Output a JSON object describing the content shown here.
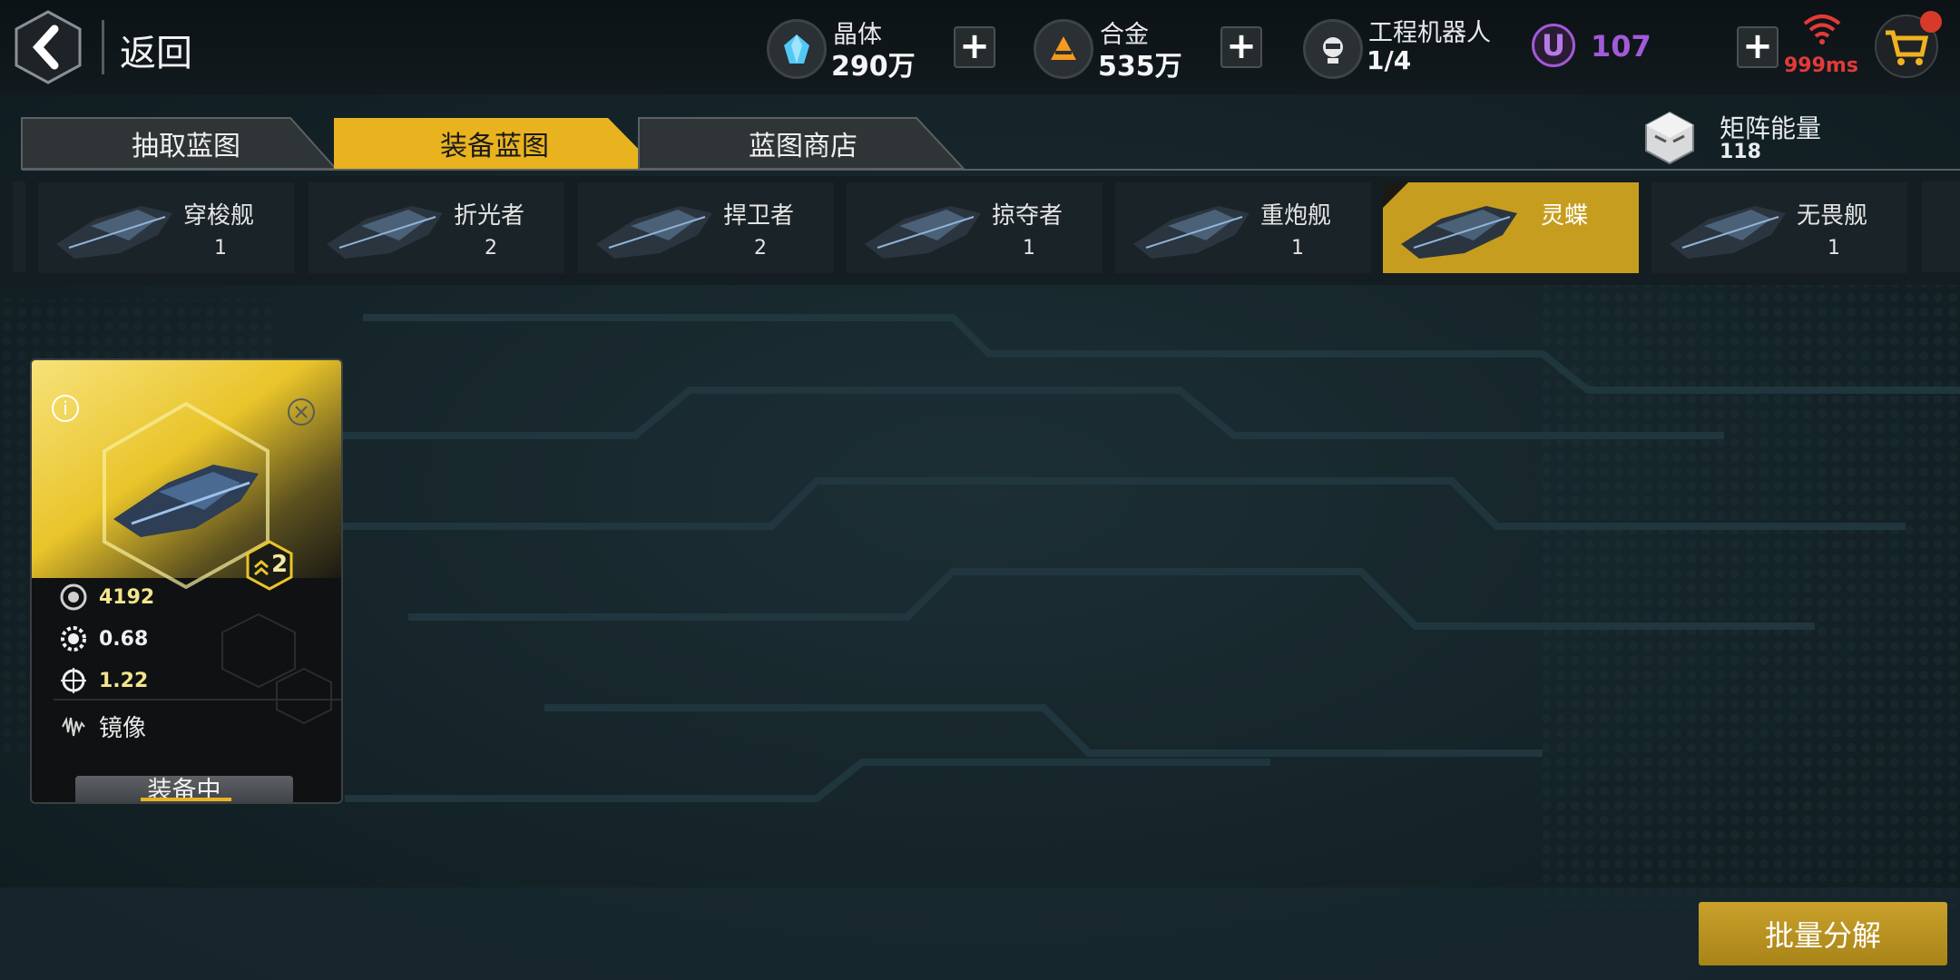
{
  "header": {
    "back_label": "返回"
  },
  "resources": [
    {
      "name": "晶体",
      "value": "290万",
      "icon": "crystal-icon",
      "color": "#52c8f5"
    },
    {
      "name": "合金",
      "value": "535万",
      "icon": "alloy-icon",
      "color": "#f59a1e"
    },
    {
      "name": "工程机器人",
      "value": "1/4",
      "icon": "robot-icon"
    }
  ],
  "premium": {
    "symbol": "U",
    "value": "107",
    "color": "#a25ad8"
  },
  "network": {
    "ping": "999ms",
    "color": "#e43a3a"
  },
  "tabs": [
    {
      "label": "抽取蓝图",
      "active": false
    },
    {
      "label": "装备蓝图",
      "active": true
    },
    {
      "label": "蓝图商店",
      "active": false
    }
  ],
  "matrix": {
    "label": "矩阵能量",
    "value": "118"
  },
  "ships": [
    {
      "name": "穿梭舰",
      "count": "1"
    },
    {
      "name": "折光者",
      "count": "2"
    },
    {
      "name": "捍卫者",
      "count": "2"
    },
    {
      "name": "掠夺者",
      "count": "1"
    },
    {
      "name": "重炮舰",
      "count": "1"
    },
    {
      "name": "灵蝶",
      "count": "",
      "selected": true
    },
    {
      "name": "无畏舰",
      "count": "1"
    }
  ],
  "card": {
    "info_symbol": "i",
    "level": "2",
    "stats": [
      {
        "icon": "power-icon",
        "value": "4192",
        "color": "#f3e58a"
      },
      {
        "icon": "gear-icon",
        "value": "0.68",
        "color": "#f0f0f0"
      },
      {
        "icon": "crosshair-icon",
        "value": "1.22",
        "color": "#f3e58a"
      }
    ],
    "trait_label": "镜像",
    "status_label": "装备中"
  },
  "actions": {
    "decompose_label": "批量分解"
  },
  "colors": {
    "accent": "#e9b320",
    "tab_inactive": "#2f3437"
  }
}
